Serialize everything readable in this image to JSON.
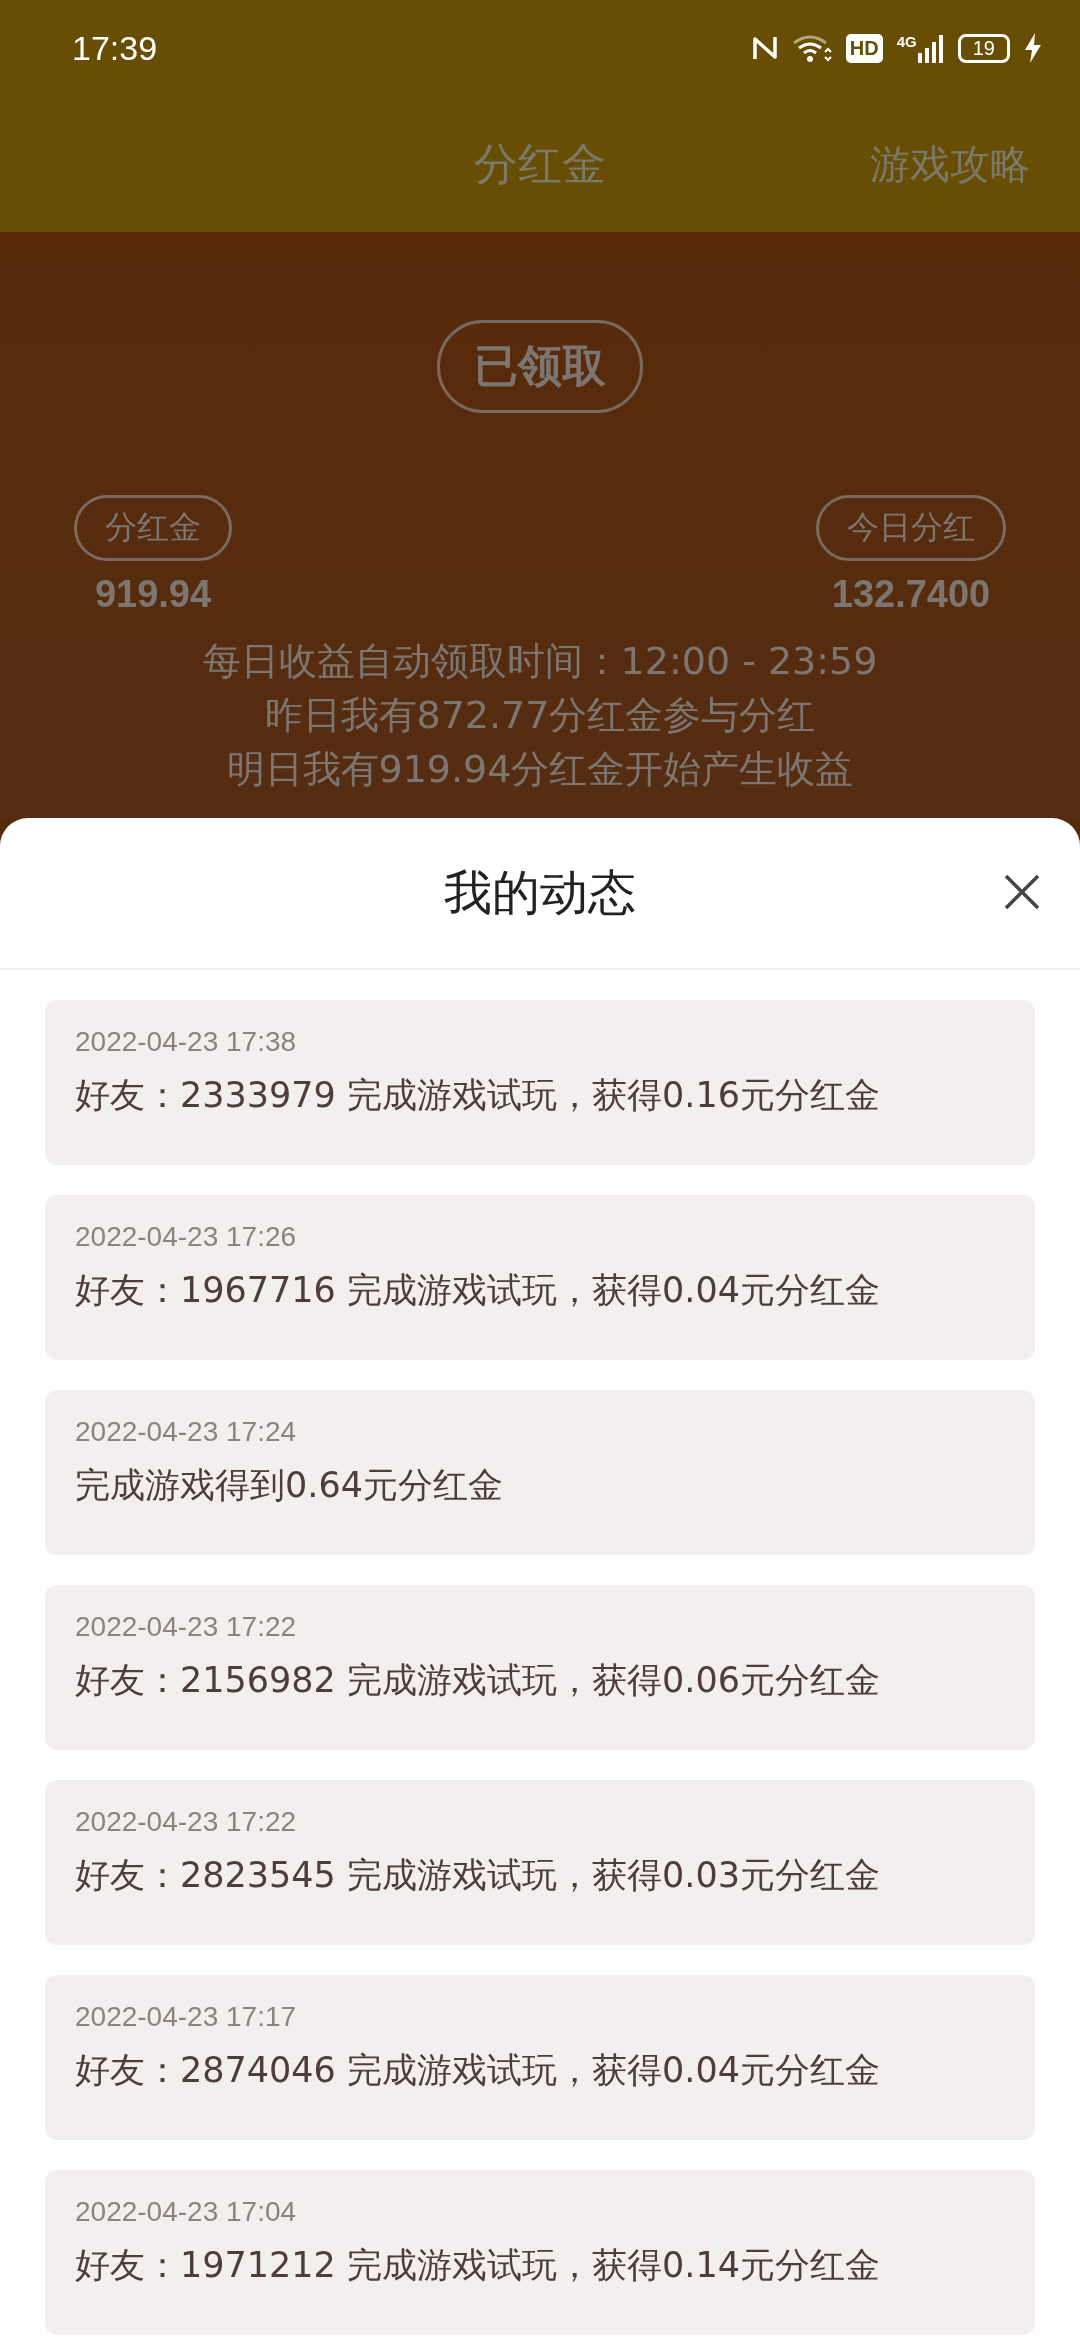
{
  "status_bar": {
    "time": "17:39",
    "hd": "HD",
    "network": "4G",
    "battery": "19"
  },
  "header": {
    "title": "分红金",
    "action": "游戏攻略"
  },
  "summary": {
    "button": "已领取",
    "left": {
      "label": "分红金",
      "value": "919.94"
    },
    "right": {
      "label": "今日分红",
      "value": "132.7400"
    },
    "notes": [
      "每日收益自动领取时间：12:00 - 23:59",
      "昨日我有872.77分红金参与分红",
      "明日我有919.94分红金开始产生收益"
    ]
  },
  "sheet": {
    "title": "我的动态",
    "items": [
      {
        "time": "2022-04-23 17:38",
        "text": "好友：2333979 完成游戏试玩，获得0.16元分红金"
      },
      {
        "time": "2022-04-23 17:26",
        "text": "好友：1967716 完成游戏试玩，获得0.04元分红金"
      },
      {
        "time": "2022-04-23 17:24",
        "text": "完成游戏得到0.64元分红金"
      },
      {
        "time": "2022-04-23 17:22",
        "text": "好友：2156982 完成游戏试玩，获得0.06元分红金"
      },
      {
        "time": "2022-04-23 17:22",
        "text": "好友：2823545 完成游戏试玩，获得0.03元分红金"
      },
      {
        "time": "2022-04-23 17:17",
        "text": "好友：2874046 完成游戏试玩，获得0.04元分红金"
      },
      {
        "time": "2022-04-23 17:04",
        "text": "好友：1971212 完成游戏试玩，获得0.14元分红金"
      }
    ]
  }
}
